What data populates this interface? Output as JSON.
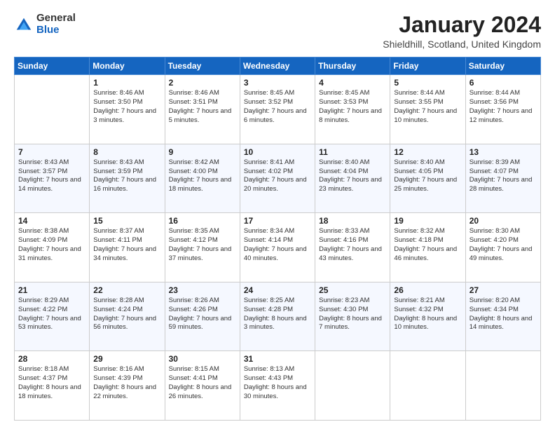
{
  "logo": {
    "general": "General",
    "blue": "Blue"
  },
  "title": "January 2024",
  "location": "Shieldhill, Scotland, United Kingdom",
  "days": [
    "Sunday",
    "Monday",
    "Tuesday",
    "Wednesday",
    "Thursday",
    "Friday",
    "Saturday"
  ],
  "weeks": [
    [
      {
        "num": "",
        "sunrise": "",
        "sunset": "",
        "daylight": ""
      },
      {
        "num": "1",
        "sunrise": "Sunrise: 8:46 AM",
        "sunset": "Sunset: 3:50 PM",
        "daylight": "Daylight: 7 hours and 3 minutes."
      },
      {
        "num": "2",
        "sunrise": "Sunrise: 8:46 AM",
        "sunset": "Sunset: 3:51 PM",
        "daylight": "Daylight: 7 hours and 5 minutes."
      },
      {
        "num": "3",
        "sunrise": "Sunrise: 8:45 AM",
        "sunset": "Sunset: 3:52 PM",
        "daylight": "Daylight: 7 hours and 6 minutes."
      },
      {
        "num": "4",
        "sunrise": "Sunrise: 8:45 AM",
        "sunset": "Sunset: 3:53 PM",
        "daylight": "Daylight: 7 hours and 8 minutes."
      },
      {
        "num": "5",
        "sunrise": "Sunrise: 8:44 AM",
        "sunset": "Sunset: 3:55 PM",
        "daylight": "Daylight: 7 hours and 10 minutes."
      },
      {
        "num": "6",
        "sunrise": "Sunrise: 8:44 AM",
        "sunset": "Sunset: 3:56 PM",
        "daylight": "Daylight: 7 hours and 12 minutes."
      }
    ],
    [
      {
        "num": "7",
        "sunrise": "Sunrise: 8:43 AM",
        "sunset": "Sunset: 3:57 PM",
        "daylight": "Daylight: 7 hours and 14 minutes."
      },
      {
        "num": "8",
        "sunrise": "Sunrise: 8:43 AM",
        "sunset": "Sunset: 3:59 PM",
        "daylight": "Daylight: 7 hours and 16 minutes."
      },
      {
        "num": "9",
        "sunrise": "Sunrise: 8:42 AM",
        "sunset": "Sunset: 4:00 PM",
        "daylight": "Daylight: 7 hours and 18 minutes."
      },
      {
        "num": "10",
        "sunrise": "Sunrise: 8:41 AM",
        "sunset": "Sunset: 4:02 PM",
        "daylight": "Daylight: 7 hours and 20 minutes."
      },
      {
        "num": "11",
        "sunrise": "Sunrise: 8:40 AM",
        "sunset": "Sunset: 4:04 PM",
        "daylight": "Daylight: 7 hours and 23 minutes."
      },
      {
        "num": "12",
        "sunrise": "Sunrise: 8:40 AM",
        "sunset": "Sunset: 4:05 PM",
        "daylight": "Daylight: 7 hours and 25 minutes."
      },
      {
        "num": "13",
        "sunrise": "Sunrise: 8:39 AM",
        "sunset": "Sunset: 4:07 PM",
        "daylight": "Daylight: 7 hours and 28 minutes."
      }
    ],
    [
      {
        "num": "14",
        "sunrise": "Sunrise: 8:38 AM",
        "sunset": "Sunset: 4:09 PM",
        "daylight": "Daylight: 7 hours and 31 minutes."
      },
      {
        "num": "15",
        "sunrise": "Sunrise: 8:37 AM",
        "sunset": "Sunset: 4:11 PM",
        "daylight": "Daylight: 7 hours and 34 minutes."
      },
      {
        "num": "16",
        "sunrise": "Sunrise: 8:35 AM",
        "sunset": "Sunset: 4:12 PM",
        "daylight": "Daylight: 7 hours and 37 minutes."
      },
      {
        "num": "17",
        "sunrise": "Sunrise: 8:34 AM",
        "sunset": "Sunset: 4:14 PM",
        "daylight": "Daylight: 7 hours and 40 minutes."
      },
      {
        "num": "18",
        "sunrise": "Sunrise: 8:33 AM",
        "sunset": "Sunset: 4:16 PM",
        "daylight": "Daylight: 7 hours and 43 minutes."
      },
      {
        "num": "19",
        "sunrise": "Sunrise: 8:32 AM",
        "sunset": "Sunset: 4:18 PM",
        "daylight": "Daylight: 7 hours and 46 minutes."
      },
      {
        "num": "20",
        "sunrise": "Sunrise: 8:30 AM",
        "sunset": "Sunset: 4:20 PM",
        "daylight": "Daylight: 7 hours and 49 minutes."
      }
    ],
    [
      {
        "num": "21",
        "sunrise": "Sunrise: 8:29 AM",
        "sunset": "Sunset: 4:22 PM",
        "daylight": "Daylight: 7 hours and 53 minutes."
      },
      {
        "num": "22",
        "sunrise": "Sunrise: 8:28 AM",
        "sunset": "Sunset: 4:24 PM",
        "daylight": "Daylight: 7 hours and 56 minutes."
      },
      {
        "num": "23",
        "sunrise": "Sunrise: 8:26 AM",
        "sunset": "Sunset: 4:26 PM",
        "daylight": "Daylight: 7 hours and 59 minutes."
      },
      {
        "num": "24",
        "sunrise": "Sunrise: 8:25 AM",
        "sunset": "Sunset: 4:28 PM",
        "daylight": "Daylight: 8 hours and 3 minutes."
      },
      {
        "num": "25",
        "sunrise": "Sunrise: 8:23 AM",
        "sunset": "Sunset: 4:30 PM",
        "daylight": "Daylight: 8 hours and 7 minutes."
      },
      {
        "num": "26",
        "sunrise": "Sunrise: 8:21 AM",
        "sunset": "Sunset: 4:32 PM",
        "daylight": "Daylight: 8 hours and 10 minutes."
      },
      {
        "num": "27",
        "sunrise": "Sunrise: 8:20 AM",
        "sunset": "Sunset: 4:34 PM",
        "daylight": "Daylight: 8 hours and 14 minutes."
      }
    ],
    [
      {
        "num": "28",
        "sunrise": "Sunrise: 8:18 AM",
        "sunset": "Sunset: 4:37 PM",
        "daylight": "Daylight: 8 hours and 18 minutes."
      },
      {
        "num": "29",
        "sunrise": "Sunrise: 8:16 AM",
        "sunset": "Sunset: 4:39 PM",
        "daylight": "Daylight: 8 hours and 22 minutes."
      },
      {
        "num": "30",
        "sunrise": "Sunrise: 8:15 AM",
        "sunset": "Sunset: 4:41 PM",
        "daylight": "Daylight: 8 hours and 26 minutes."
      },
      {
        "num": "31",
        "sunrise": "Sunrise: 8:13 AM",
        "sunset": "Sunset: 4:43 PM",
        "daylight": "Daylight: 8 hours and 30 minutes."
      },
      {
        "num": "",
        "sunrise": "",
        "sunset": "",
        "daylight": ""
      },
      {
        "num": "",
        "sunrise": "",
        "sunset": "",
        "daylight": ""
      },
      {
        "num": "",
        "sunrise": "",
        "sunset": "",
        "daylight": ""
      }
    ]
  ]
}
